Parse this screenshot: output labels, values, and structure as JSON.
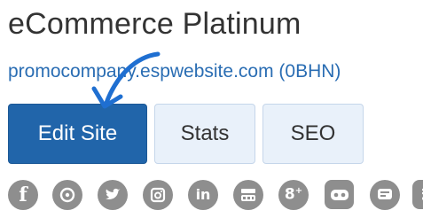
{
  "site": {
    "title": "eCommerce Platinum",
    "url": "promocompany.espwebsite.com (0BHN)"
  },
  "actions": {
    "edit_label": "Edit Site",
    "stats_label": "Stats",
    "seo_label": "SEO"
  },
  "social": [
    {
      "name": "facebook-icon"
    },
    {
      "name": "pinterest-icon"
    },
    {
      "name": "twitter-icon"
    },
    {
      "name": "instagram-icon"
    },
    {
      "name": "linkedin-icon"
    },
    {
      "name": "youtube-icon"
    },
    {
      "name": "google-plus-icon"
    },
    {
      "name": "flickr-icon"
    },
    {
      "name": "blog-icon"
    },
    {
      "name": "rss-icon"
    }
  ],
  "colors": {
    "primary": "#2165aa",
    "secondary_bg": "#e9f1fa",
    "link": "#2a6db3",
    "icon": "#8e8e8e"
  }
}
